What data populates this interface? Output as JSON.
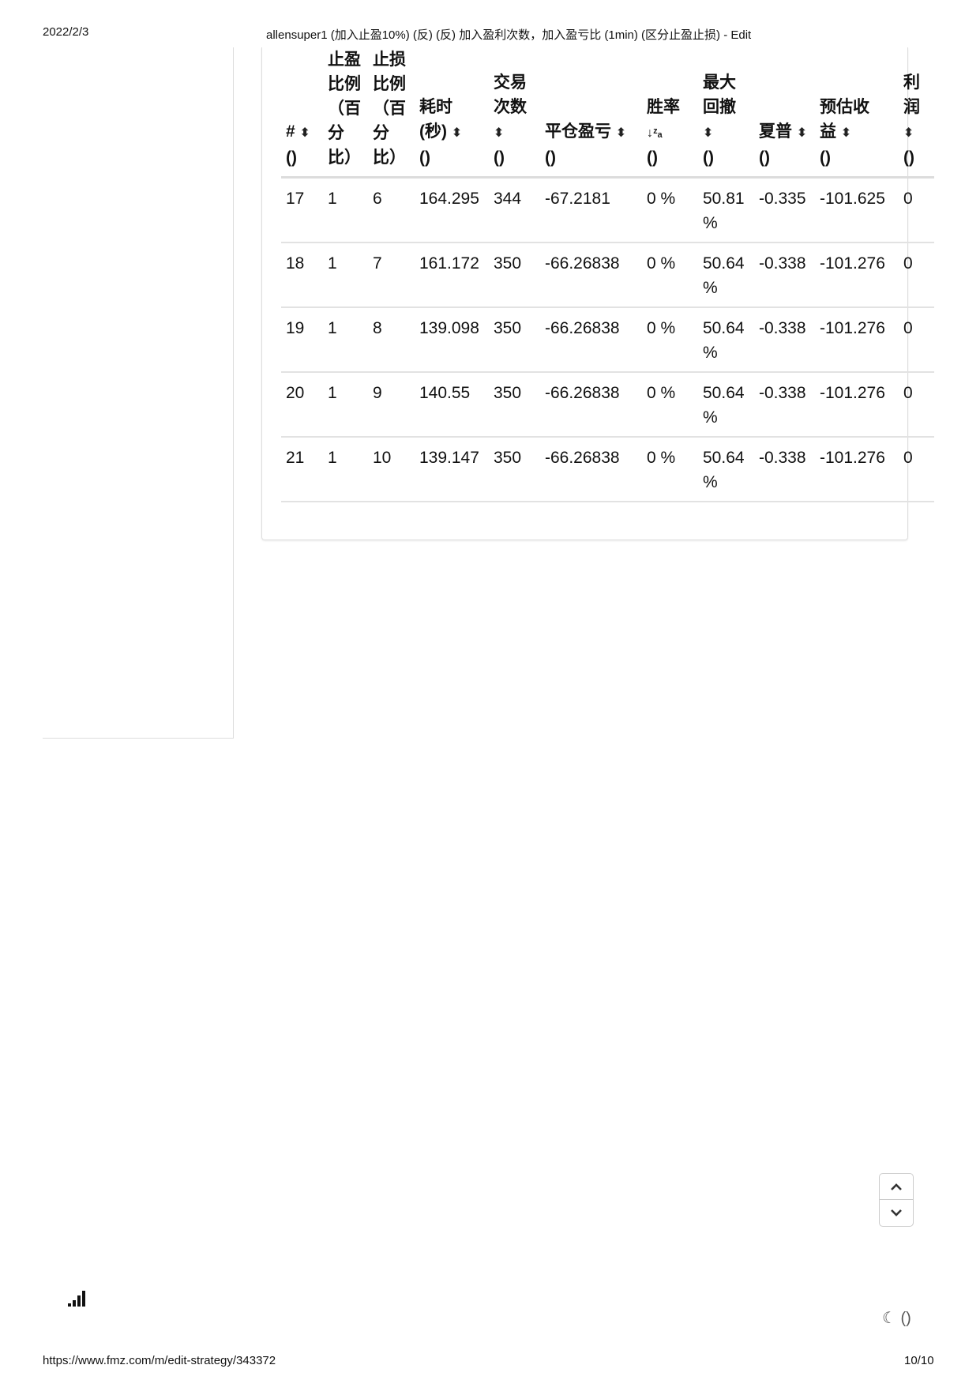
{
  "header": {
    "date": "2022/2/3",
    "title": "allensuper1 (加入止盈10%) (反) (反) 加入盈利次数，加入盈亏比 (1min) (区分止盈止损) - Edit"
  },
  "footer": {
    "url": "https://www.fmz.com/m/edit-strategy/343372",
    "page": "10/10"
  },
  "table": {
    "columns": [
      {
        "lines": [
          "#"
        ],
        "sort": "⬍",
        "suffix": "()"
      },
      {
        "lines": [
          "止盈",
          "比例",
          "（百",
          "分",
          "比）"
        ],
        "sort": "",
        "suffix": ""
      },
      {
        "lines": [
          "止损",
          "比例",
          "（百",
          "分",
          "比）"
        ],
        "sort": "",
        "suffix": ""
      },
      {
        "lines": [
          "耗时",
          "(秒)"
        ],
        "sort": "⬍",
        "suffix": "()"
      },
      {
        "lines": [
          "交易",
          "次数"
        ],
        "sort": "⬍",
        "suffix": "()"
      },
      {
        "lines": [
          "平仓盈亏"
        ],
        "sort": "⬍",
        "suffix": "()"
      },
      {
        "lines": [
          "胜率"
        ],
        "sort": "↓ᶻₐ",
        "suffix": "()"
      },
      {
        "lines": [
          "最大",
          "回撤"
        ],
        "sort": "⬍",
        "suffix": "()"
      },
      {
        "lines": [
          "夏普"
        ],
        "sort": "⬍",
        "suffix": "()"
      },
      {
        "lines": [
          "预估收",
          "益"
        ],
        "sort": "⬍",
        "suffix": "()"
      },
      {
        "lines": [
          "利",
          "润"
        ],
        "sort": "⬍",
        "suffix": "()"
      }
    ],
    "rows": [
      [
        "17",
        "1",
        "6",
        "164.295",
        "344",
        "-67.2181",
        "0 %",
        "50.81 %",
        "-0.335",
        "-101.625",
        "0"
      ],
      [
        "18",
        "1",
        "7",
        "161.172",
        "350",
        "-66.26838",
        "0 %",
        "50.64 %",
        "-0.338",
        "-101.276",
        "0"
      ],
      [
        "19",
        "1",
        "8",
        "139.098",
        "350",
        "-66.26838",
        "0 %",
        "50.64 %",
        "-0.338",
        "-101.276",
        "0"
      ],
      [
        "20",
        "1",
        "9",
        "140.55",
        "350",
        "-66.26838",
        "0 %",
        "50.64 %",
        "-0.338",
        "-101.276",
        "0"
      ],
      [
        "21",
        "1",
        "10",
        "139.147",
        "350",
        "-66.26838",
        "0 %",
        "50.64 %",
        "-0.338",
        "-101.276",
        "0"
      ]
    ]
  },
  "controls": {
    "scroll_up_icon": "chevron-up",
    "scroll_down_icon": "chevron-down",
    "theme_icon": "moon",
    "theme_suffix": "()",
    "signal_icon": "signal-bars"
  }
}
